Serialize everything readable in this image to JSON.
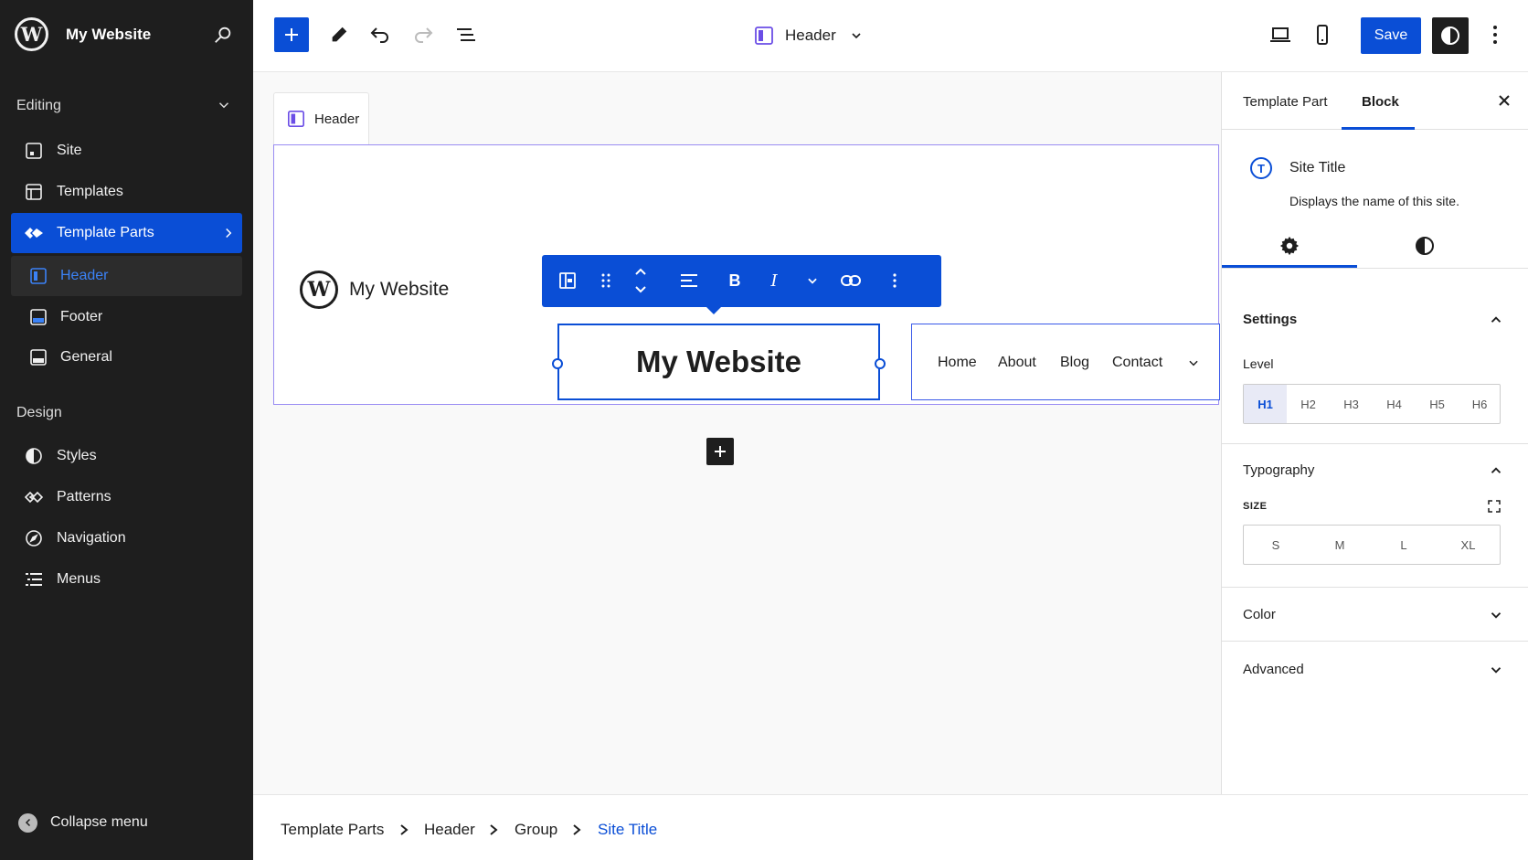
{
  "app": {
    "site_name": "My Website",
    "logo_glyph": "W"
  },
  "sidebar": {
    "section_editing": "Editing",
    "section_design": "Design",
    "items_editing": [
      {
        "label": "Site",
        "icon": "site-icon"
      },
      {
        "label": "Templates",
        "icon": "templates-icon"
      },
      {
        "label": "Template Parts",
        "icon": "template-parts-icon"
      }
    ],
    "sub_items": [
      {
        "label": "Header",
        "icon": "header-icon"
      },
      {
        "label": "Footer",
        "icon": "footer-icon"
      },
      {
        "label": "General",
        "icon": "general-icon"
      }
    ],
    "items_design": [
      {
        "label": "Styles",
        "icon": "styles-icon"
      },
      {
        "label": "Patterns",
        "icon": "patterns-icon"
      },
      {
        "label": "Navigation",
        "icon": "navigation-icon"
      },
      {
        "label": "Menus",
        "icon": "menus-icon"
      }
    ],
    "collapse_label": "Collapse menu"
  },
  "toolbar": {
    "document_title": "Header",
    "save_label": "Save"
  },
  "canvas": {
    "tab_label": "Header",
    "header_site_name": "My Website",
    "site_title_text": "My Website",
    "nav_items": [
      "Home",
      "About",
      "Blog",
      "Contact"
    ]
  },
  "panel": {
    "tabs": [
      "Template Part",
      "Block"
    ],
    "active_tab": "Block",
    "block_title": "Site Title",
    "block_icon_glyph": "T",
    "block_description": "Displays the name of this site.",
    "settings_title": "Settings",
    "level_label": "Level",
    "levels": [
      "H1",
      "H2",
      "H3",
      "H4",
      "H5",
      "H6"
    ],
    "selected_level": "H1",
    "typography_title": "Typography",
    "size_label": "SIZE",
    "sizes": [
      "S",
      "M",
      "L",
      "XL"
    ],
    "color_title": "Color",
    "advanced_title": "Advanced"
  },
  "breadcrumb": {
    "items": [
      "Template Parts",
      "Header",
      "Group",
      "Site Title"
    ]
  },
  "colors": {
    "accent": "#0a4ed6",
    "sidebar_bg": "#1e1e1e",
    "frame_border": "#9a8cf3"
  }
}
